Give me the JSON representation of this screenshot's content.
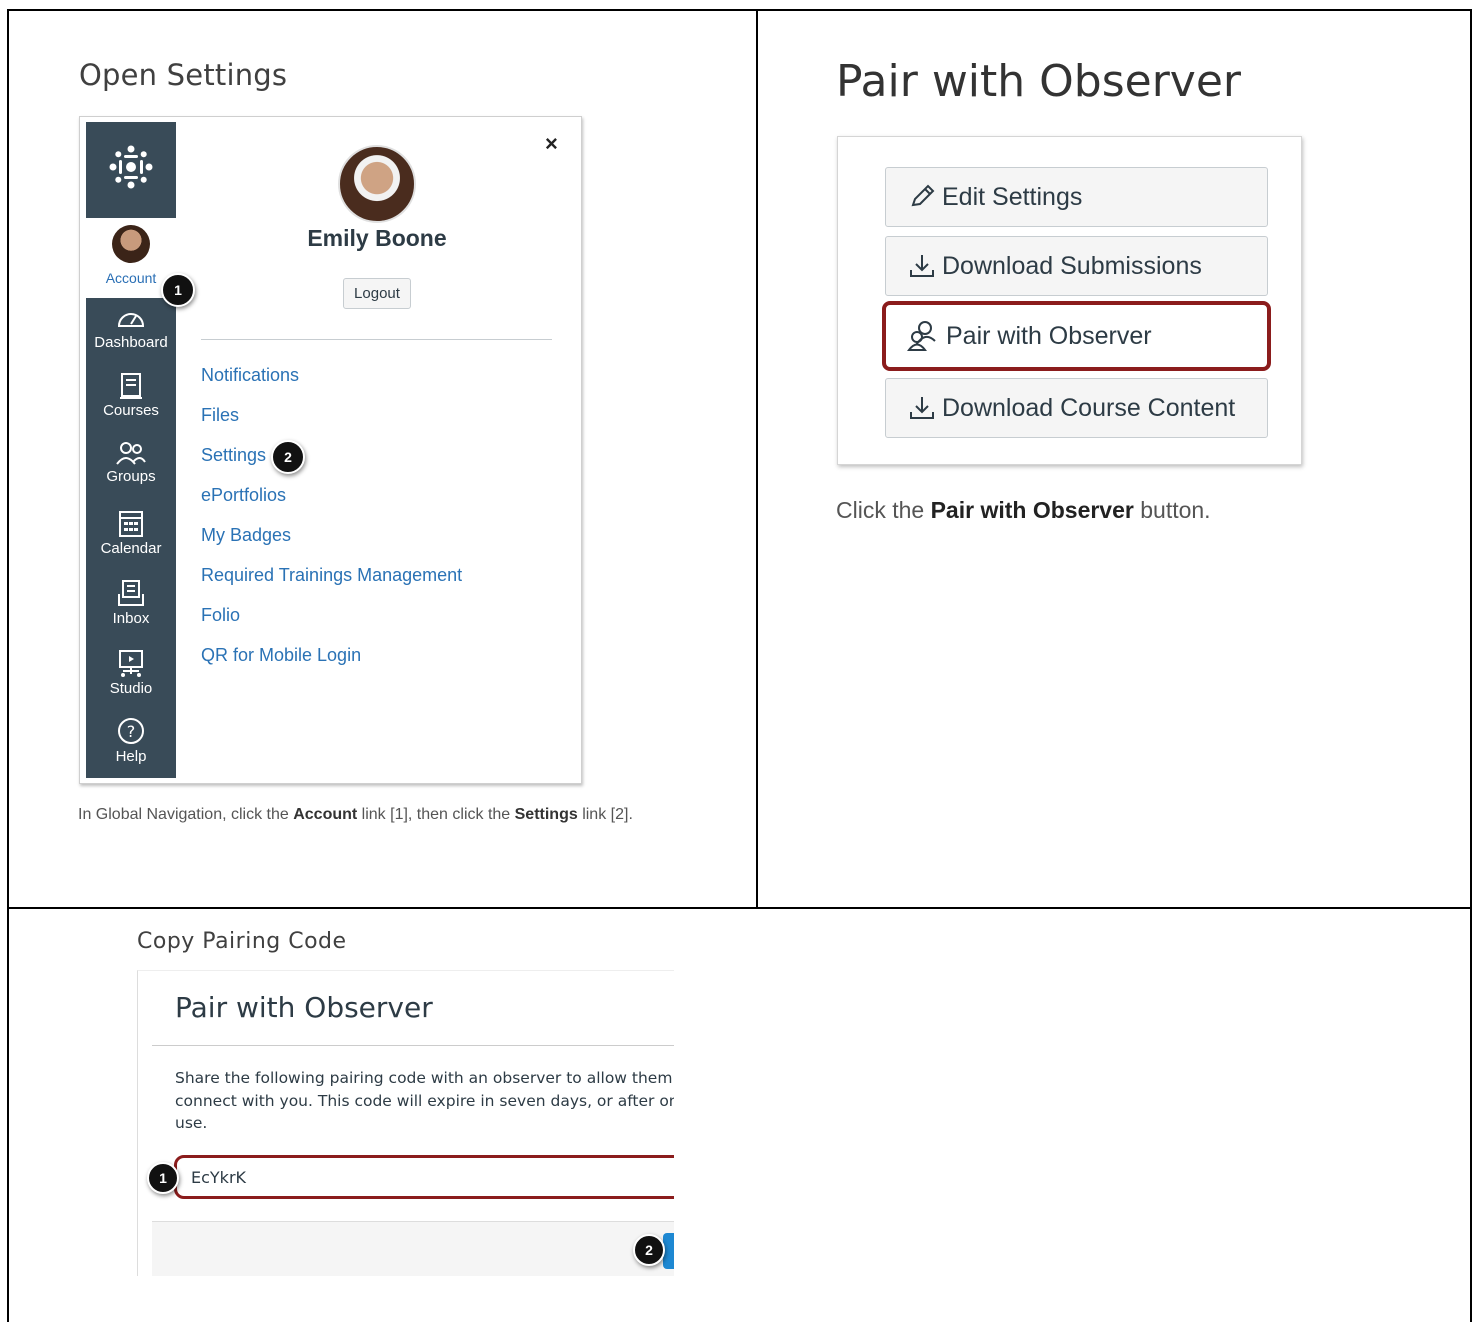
{
  "panel1": {
    "title": "Open Settings",
    "nav": {
      "account_label": "Account",
      "items": [
        {
          "label": "Dashboard",
          "icon": "dashboard-icon"
        },
        {
          "label": "Courses",
          "icon": "courses-icon"
        },
        {
          "label": "Groups",
          "icon": "groups-icon"
        },
        {
          "label": "Calendar",
          "icon": "calendar-icon"
        },
        {
          "label": "Inbox",
          "icon": "inbox-icon"
        },
        {
          "label": "Studio",
          "icon": "studio-icon"
        },
        {
          "label": "Help",
          "icon": "help-icon"
        }
      ]
    },
    "profile": {
      "name": "Emily Boone",
      "logout_label": "Logout",
      "close_glyph": "×",
      "links": [
        "Notifications",
        "Files",
        "Settings",
        "ePortfolios",
        "My Badges",
        "Required Trainings Management",
        "Folio",
        "QR for Mobile Login"
      ]
    },
    "badges": [
      "1",
      "2"
    ],
    "caption": {
      "part1": "In Global Navigation, click the ",
      "bold1": "Account",
      "part2": " link [1], then click the ",
      "bold2": "Settings",
      "part3": " link [2]."
    }
  },
  "panel2": {
    "title": "Pair with Observer",
    "buttons": [
      {
        "label": "Edit Settings",
        "icon": "pencil-icon"
      },
      {
        "label": "Download Submissions",
        "icon": "download-icon"
      },
      {
        "label": "Pair with Observer",
        "icon": "observer-icon"
      },
      {
        "label": "Download Course Content",
        "icon": "download-icon"
      }
    ],
    "caption": {
      "part1": "Click the ",
      "bold": "Pair with Observer",
      "part2": " button."
    }
  },
  "panel3": {
    "title": "Copy Pairing Code",
    "dialog_title": "Pair with Observer",
    "description": "Share the following pairing code with an observer to allow them to connect with you. This code will expire in seven days, or after one use.",
    "code": "EcYkrK",
    "badges": [
      "1",
      "2"
    ]
  },
  "colors": {
    "nav_bg": "#394b58",
    "link": "#2a72b5",
    "highlight": "#8b1c1c",
    "button_blue": "#1e88d2"
  }
}
